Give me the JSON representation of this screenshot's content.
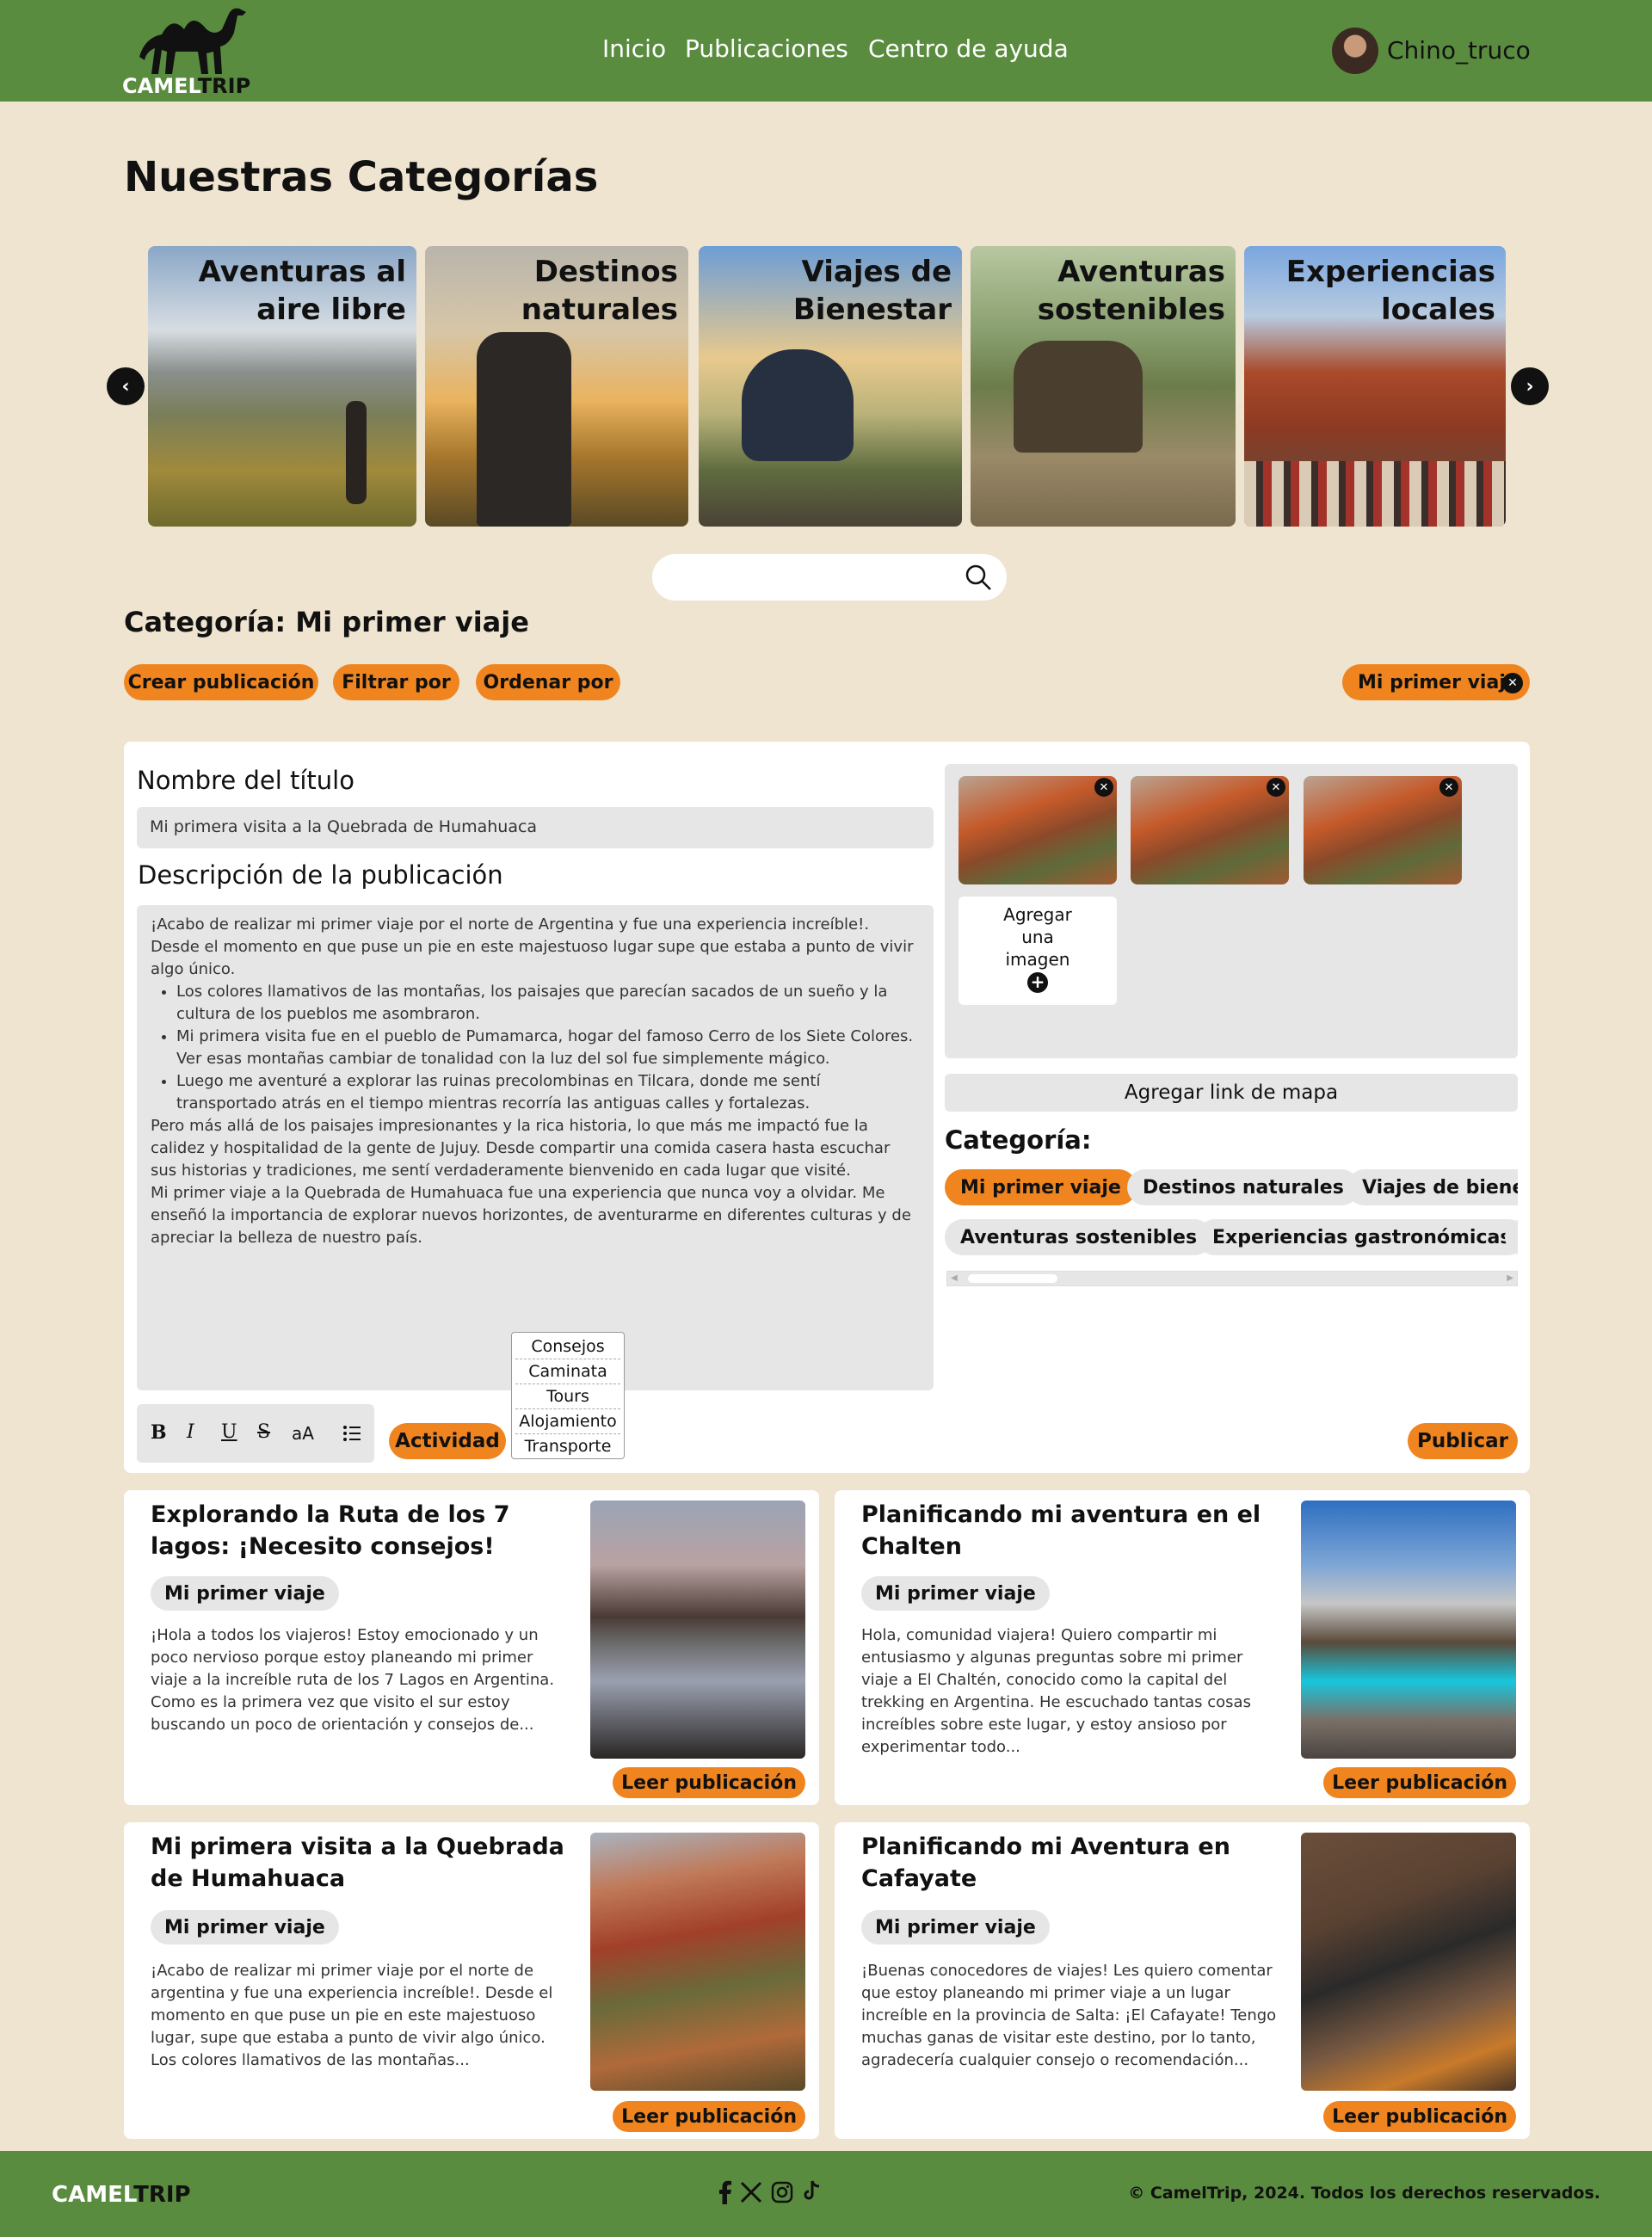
{
  "header": {
    "logo_part1": "CAMEL",
    "logo_part2": "TRIP",
    "nav": [
      "Inicio",
      "Publicaciones",
      "Centro de ayuda"
    ],
    "username": "Chino_truco"
  },
  "categories_section": {
    "title": "Nuestras Categorías",
    "items": [
      {
        "label_line1": "Aventuras al",
        "label_line2": "aire libre"
      },
      {
        "label_line1": "Destinos",
        "label_line2": "naturales"
      },
      {
        "label_line1": "Viajes de",
        "label_line2": "Bienestar"
      },
      {
        "label_line1": "Aventuras",
        "label_line2": "sostenibles"
      },
      {
        "label_line1": "Experiencias",
        "label_line2": "locales"
      }
    ]
  },
  "search": {
    "placeholder": ""
  },
  "category_bar": {
    "title": "Categoría: Mi primer viaje",
    "create_label": "Crear publicación",
    "filter_label": "Filtrar por",
    "sort_label": "Ordenar por",
    "active_filter": "Mi primer viaje"
  },
  "editor": {
    "title_label": "Nombre del título",
    "title_value": "Mi primera visita a la Quebrada de Humahuaca",
    "desc_label": "Descripción de la publicación",
    "desc_intro": "¡Acabo de realizar mi primer viaje por el norte de Argentina y fue una experiencia increíble!. Desde el momento en que puse un pie en este majestuoso lugar supe que estaba a punto de vivir algo único.",
    "desc_bullets": [
      "Los colores llamativos de las montañas, los paisajes que parecían sacados de un sueño y la cultura de los pueblos me asombraron.",
      "Mi primera visita fue en el pueblo de Pumamarca, hogar del famoso Cerro de los Siete Colores. Ver esas montañas cambiar de tonalidad con la luz del sol fue simplemente mágico.",
      " Luego me aventuré a explorar las ruinas precolombinas en Tilcara, donde me sentí transportado atrás en el tiempo mientras recorría las antiguas calles y fortalezas."
    ],
    "desc_p2": "Pero más allá de los paisajes impresionantes y la rica historia, lo que más me impactó fue la calidez y hospitalidad de la gente de Jujuy. Desde compartir una comida casera hasta escuchar sus historias y tradiciones, me sentí verdaderamente bienvenido en cada lugar que visité.",
    "desc_p3": "Mi primer viaje a la Quebrada de Humahuaca fue una experiencia que nunca voy a olvidar. Me enseñó la importancia de explorar nuevos horizontes, de aventurarme en diferentes culturas y de apreciar la belleza de nuestro país.",
    "toolbar": {
      "bold": "B",
      "italic": "I",
      "underline": "U",
      "strike": "S",
      "fontsize": "aA"
    },
    "activity_label": "Actividad",
    "activity_options": [
      "Consejos",
      "Caminata",
      "Tours",
      "Alojamiento",
      "Transporte"
    ],
    "add_image_line1": "Agregar",
    "add_image_line2": "una",
    "add_image_line3": "imagen",
    "map_link_label": "Agregar link de mapa",
    "category_label": "Categoría:",
    "category_chips": [
      "Mi primer viaje",
      "Destinos naturales",
      "Viajes de bienes",
      "Aventuras sostenibles",
      "Experiencias gastronómicas"
    ],
    "publish_label": "Publicar"
  },
  "posts": [
    {
      "title": "Explorando la Ruta de los 7 lagos: ¡Necesito consejos!",
      "tag": "Mi primer viaje",
      "body": "¡Hola a todos los viajeros! Estoy emocionado y un poco nervioso porque estoy planeando mi primer viaje a la increíble ruta de los 7 Lagos en Argentina. Como es la primera vez que visito el sur estoy buscando un poco de orientación y consejos de...",
      "read": "Leer publicación"
    },
    {
      "title": "Planificando mi aventura en el Chalten",
      "tag": "Mi primer viaje",
      "body": "Hola, comunidad viajera! Quiero compartir mi entusiasmo y algunas preguntas sobre mi primer viaje a El Chaltén, conocido como la capital del trekking en Argentina. He escuchado tantas cosas increíbles sobre este lugar, y estoy ansioso por experimentar todo...",
      "read": "Leer publicación"
    },
    {
      "title": "Mi primera visita a la Quebrada de Humahuaca",
      "tag": "Mi primer viaje",
      "body": "¡Acabo de realizar mi primer viaje por el norte de argentina y fue una experiencia increíble!. Desde el momento en que puse un pie en este majestuoso lugar, supe que estaba a punto de vivir  algo único. Los colores llamativos de las montañas...",
      "read": "Leer publicación"
    },
    {
      "title": "Planificando mi Aventura en Cafayate",
      "tag": "Mi primer viaje",
      "body": "¡Buenas conocedores de viajes! Les quiero comentar que estoy planeando mi primer viaje a un lugar increíble en la provincia de Salta: ¡El Cafayate! Tengo muchas ganas de visitar este destino, por lo tanto, agradecería cualquier consejo o recomendación...",
      "read": "Leer publicación"
    }
  ],
  "footer": {
    "logo_part1": "CAMEL",
    "logo_part2": "TRIP",
    "copyright": "© CamelTrip, 2024. Todos los derechos reservados.",
    "social_icons": [
      "facebook-icon",
      "x-icon",
      "instagram-icon",
      "tiktok-icon"
    ]
  },
  "colors": {
    "header_green": "#5a8c3f",
    "accent_orange": "#f0841e",
    "background": "#efe4d0"
  }
}
